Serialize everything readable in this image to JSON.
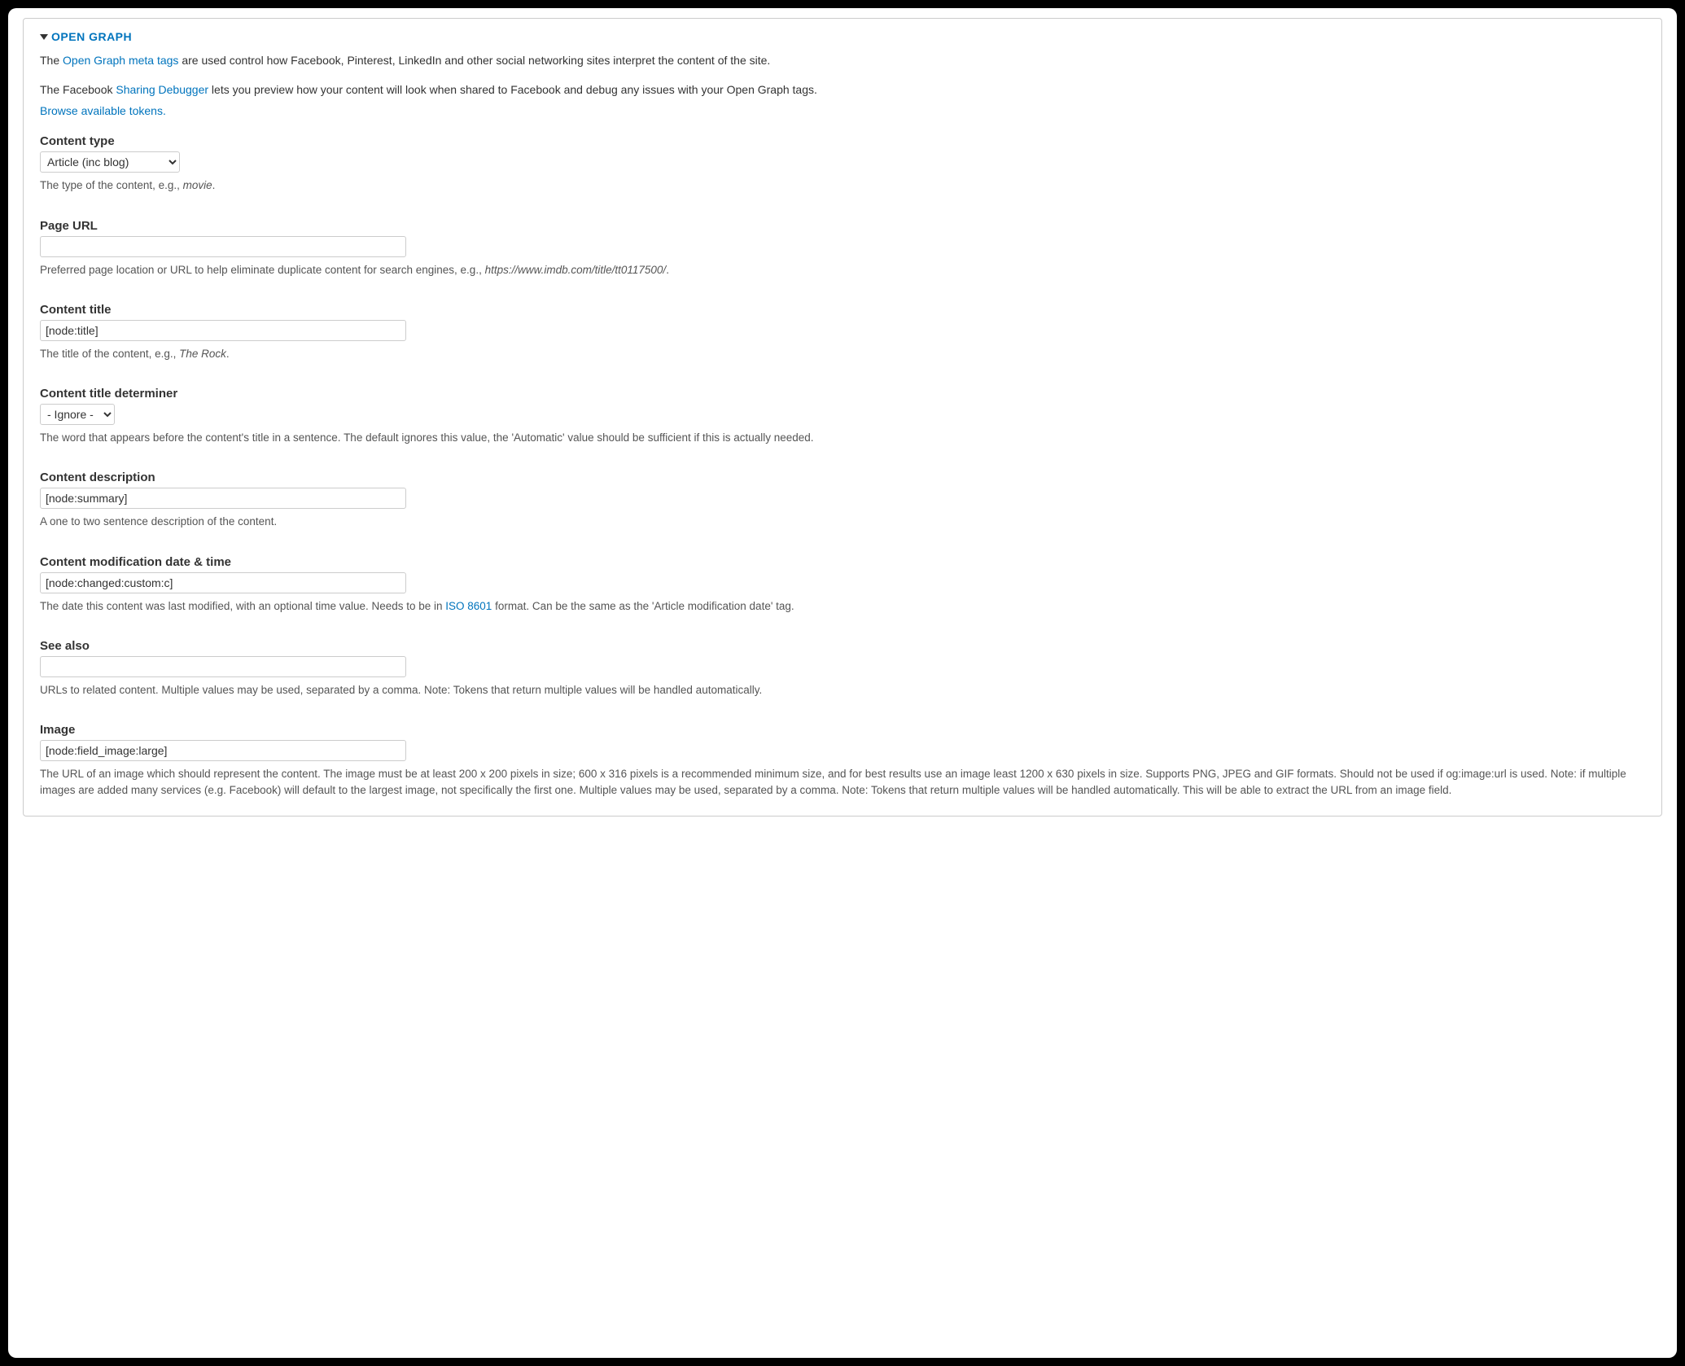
{
  "section": {
    "title": "OPEN GRAPH"
  },
  "intro": {
    "prefix1": "The ",
    "link1": "Open Graph meta tags",
    "suffix1": " are used control how Facebook, Pinterest, LinkedIn and other social networking sites interpret the content of the site.",
    "prefix2": "The Facebook ",
    "link2": "Sharing Debugger",
    "suffix2": " lets you preview how your content will look when shared to Facebook and debug any issues with your Open Graph tags.",
    "tokens_link": "Browse available tokens."
  },
  "fields": {
    "content_type": {
      "label": "Content type",
      "value": "Article (inc blog)",
      "desc_prefix": "The type of the content, e.g., ",
      "desc_em": "movie",
      "desc_suffix": "."
    },
    "page_url": {
      "label": "Page URL",
      "value": "",
      "desc_prefix": "Preferred page location or URL to help eliminate duplicate content for search engines, e.g., ",
      "desc_em": "https://www.imdb.com/title/tt0117500/",
      "desc_suffix": "."
    },
    "content_title": {
      "label": "Content title",
      "value": "[node:title]",
      "desc_prefix": "The title of the content, e.g., ",
      "desc_em": "The Rock",
      "desc_suffix": "."
    },
    "determiner": {
      "label": "Content title determiner",
      "value": "- Ignore -",
      "desc": "The word that appears before the content's title in a sentence. The default ignores this value, the 'Automatic' value should be sufficient if this is actually needed."
    },
    "content_description": {
      "label": "Content description",
      "value": "[node:summary]",
      "desc": "A one to two sentence description of the content."
    },
    "modification": {
      "label": "Content modification date & time",
      "value": "[node:changed:custom:c]",
      "desc_prefix": "The date this content was last modified, with an optional time value. Needs to be in ",
      "desc_link": "ISO 8601",
      "desc_suffix": " format. Can be the same as the 'Article modification date' tag."
    },
    "see_also": {
      "label": "See also",
      "value": "",
      "desc": "URLs to related content. Multiple values may be used, separated by a comma. Note: Tokens that return multiple values will be handled automatically."
    },
    "image": {
      "label": "Image",
      "value": "[node:field_image:large]",
      "desc": "The URL of an image which should represent the content. The image must be at least 200 x 200 pixels in size; 600 x 316 pixels is a recommended minimum size, and for best results use an image least 1200 x 630 pixels in size. Supports PNG, JPEG and GIF formats. Should not be used if og:image:url is used. Note: if multiple images are added many services (e.g. Facebook) will default to the largest image, not specifically the first one. Multiple values may be used, separated by a comma. Note: Tokens that return multiple values will be handled automatically. This will be able to extract the URL from an image field."
    }
  }
}
